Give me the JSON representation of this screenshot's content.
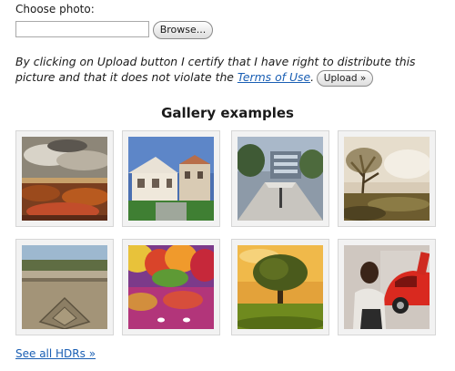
{
  "upload": {
    "choose_label": "Choose photo:",
    "file_value": "",
    "browse_label": "Browse...",
    "notice_text": "By clicking on Upload button I certify that I have right to distribute this picture and that it does not violate the ",
    "terms_link": "Terms of Use",
    "notice_end": ".",
    "upload_label": "Upload »"
  },
  "gallery": {
    "title": "Gallery examples",
    "items": [
      {
        "icon": "stormy-sky-landscape-image"
      },
      {
        "icon": "villa-street-image"
      },
      {
        "icon": "city-plaza-image"
      },
      {
        "icon": "misty-tree-image"
      },
      {
        "icon": "stone-courtyard-image"
      },
      {
        "icon": "autumn-lake-swans-image"
      },
      {
        "icon": "lone-tree-sunset-image"
      },
      {
        "icon": "man-with-sportscar-image"
      }
    ]
  },
  "see_all": "See all HDRs »"
}
